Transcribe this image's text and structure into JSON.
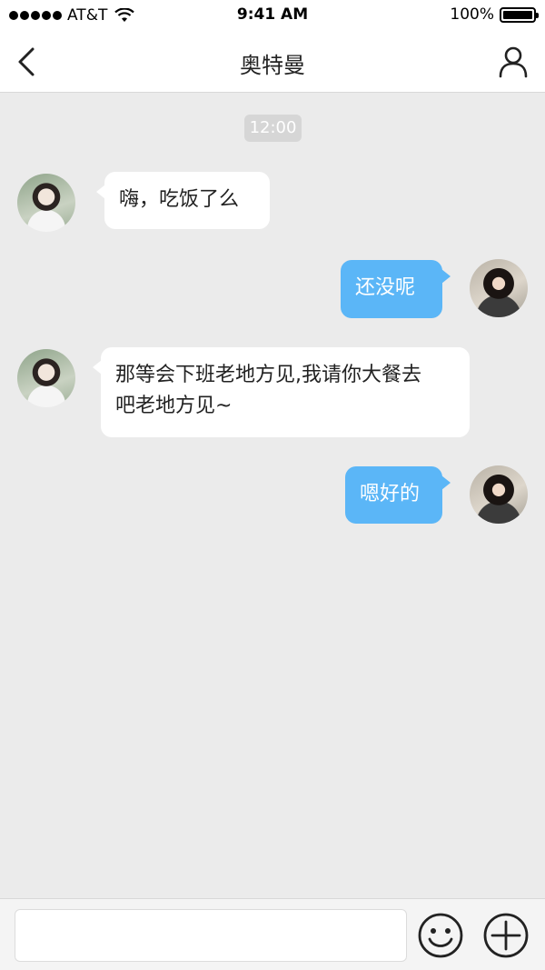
{
  "status_bar": {
    "carrier": "AT&T",
    "time": "9:41 AM",
    "battery": "100%",
    "battery_level": 1.0
  },
  "nav": {
    "title": "奥特曼",
    "back_icon": "chevron-left-icon",
    "profile_icon": "user-icon"
  },
  "chat": {
    "timestamp": "12:00",
    "messages": [
      {
        "side": "left",
        "text": "嗨，吃饭了么"
      },
      {
        "side": "right",
        "text": "还没呢"
      },
      {
        "side": "left",
        "text": "那等会下班老地方见,我请你大餐去\n吧老地方见~"
      },
      {
        "side": "right",
        "text": "嗯好的"
      }
    ]
  },
  "input_bar": {
    "placeholder": "",
    "value": "",
    "emoji_icon": "smiley-icon",
    "plus_icon": "plus-circle-icon"
  },
  "colors": {
    "outgoing_bubble": "#5bb6f7",
    "incoming_bubble": "#ffffff",
    "chat_background": "#ebebeb"
  }
}
